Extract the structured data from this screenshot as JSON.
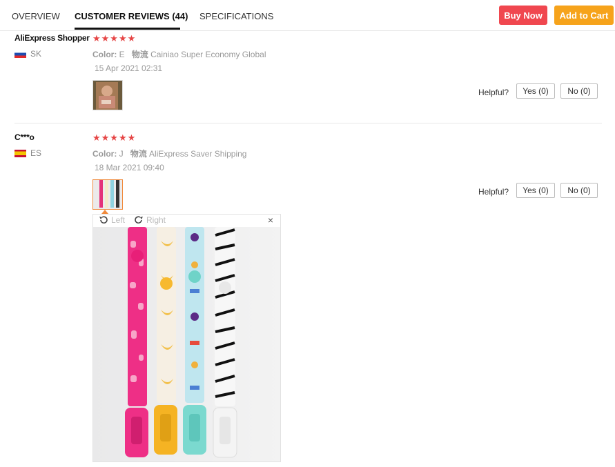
{
  "tabs": [
    {
      "label": "OVERVIEW"
    },
    {
      "label": "CUSTOMER REVIEWS (44)"
    },
    {
      "label": "SPECIFICATIONS"
    }
  ],
  "actions": {
    "buy_now": "Buy Now",
    "add_to_cart": "Add to Cart"
  },
  "colors": {
    "buy": "#f0474f",
    "cart": "#f6a31b",
    "stars": "#e64545"
  },
  "reviews": [
    {
      "user": "AliExpress Shopper",
      "country": "SK",
      "stars": "★★★★★",
      "color_label": "Color:",
      "color_value": "E",
      "shipping_label": "物流",
      "shipping_value": "Cainiao Super Economy Global",
      "date": "15 Apr 2021 02:31",
      "helpful": "Helpful?",
      "yes": "Yes (0)",
      "no": "No (0)"
    },
    {
      "user": "C***o",
      "country": "ES",
      "stars": "★★★★★",
      "color_label": "Color:",
      "color_value": "J",
      "shipping_label": "物流",
      "shipping_value": "AliExpress Saver Shipping",
      "date": "18 Mar 2021 09:40",
      "helpful": "Helpful?",
      "yes": "Yes (0)",
      "no": "No (0)"
    }
  ],
  "viewer": {
    "rotate_left": "Left",
    "rotate_right": "Right",
    "close": "×"
  }
}
